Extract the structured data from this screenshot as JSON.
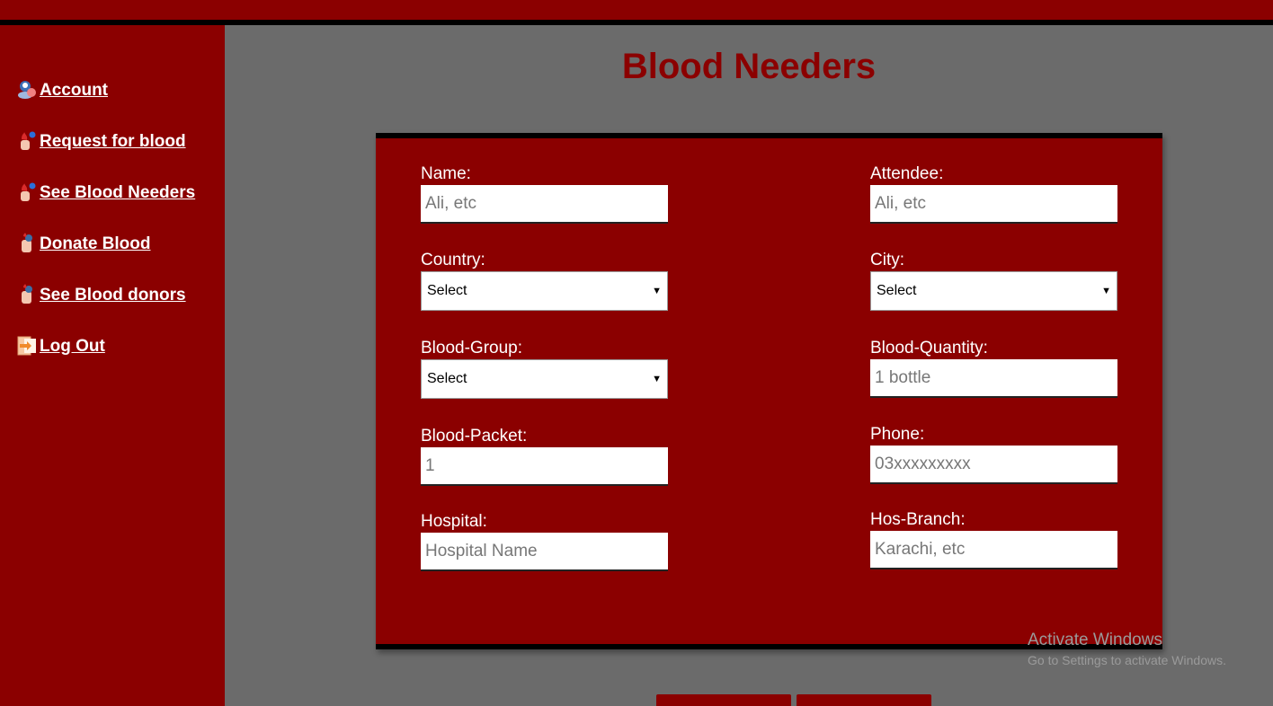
{
  "app": {
    "title": "Blood Needers"
  },
  "sidebar": {
    "items": [
      {
        "label": " Account",
        "icon": "user-account-icon"
      },
      {
        "label": " Request for blood",
        "icon": "blood-drop-hand-icon"
      },
      {
        "label": " See Blood Needers",
        "icon": "blood-drop-hand-icon"
      },
      {
        "label": "Donate Blood",
        "icon": "donate-hand-icon"
      },
      {
        "label": " See Blood donors",
        "icon": "donate-hand-icon"
      },
      {
        "label": " Log Out",
        "icon": "logout-door-icon"
      }
    ]
  },
  "form": {
    "name": {
      "label": "Name:",
      "placeholder": "Ali, etc"
    },
    "attendee": {
      "label": "Attendee:",
      "placeholder": "Ali, etc"
    },
    "country": {
      "label": "Country:",
      "value": "Select"
    },
    "city": {
      "label": "City:",
      "value": "Select"
    },
    "blood_group": {
      "label": "Blood-Group:",
      "value": "Select"
    },
    "blood_quantity": {
      "label": "Blood-Quantity:",
      "placeholder": "1 bottle"
    },
    "blood_packet": {
      "label": "Blood-Packet:",
      "placeholder": "1"
    },
    "phone": {
      "label": "Phone:",
      "placeholder": "03xxxxxxxxx"
    },
    "hospital": {
      "label": "Hospital:",
      "placeholder": "Hospital Name"
    },
    "hos_branch": {
      "label": "Hos-Branch:",
      "placeholder": "Karachi, etc"
    }
  },
  "watermark": {
    "title": "Activate Windows",
    "subtitle": "Go to Settings to activate Windows."
  },
  "colors": {
    "primary": "#8b0000",
    "background": "#6b6b6b",
    "border": "#000000"
  }
}
